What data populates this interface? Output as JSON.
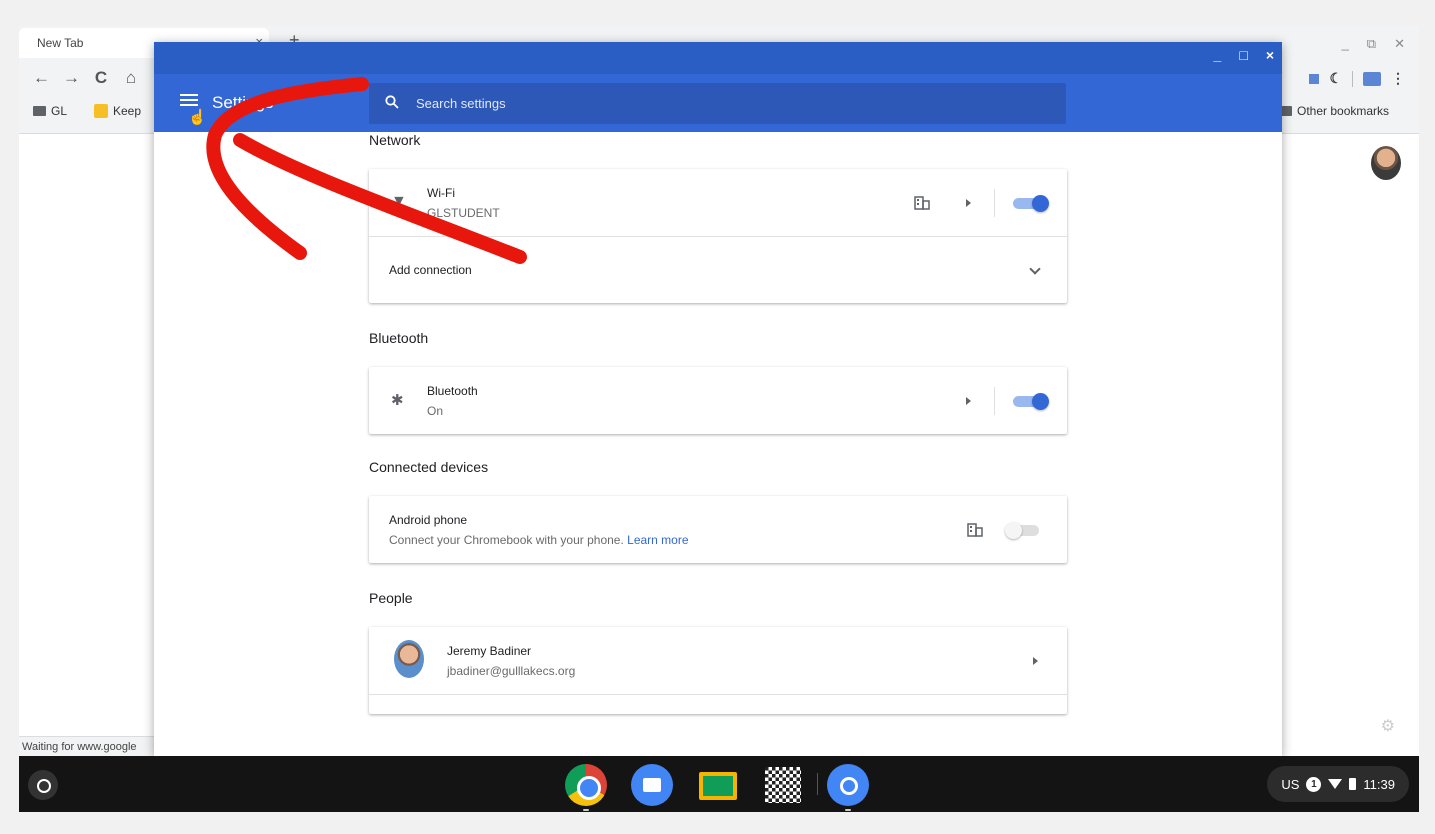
{
  "browser": {
    "tab_title": "New Tab",
    "tab_close": "×",
    "new_tab": "+",
    "bookmarks": [
      {
        "label": "GL"
      },
      {
        "label": "Keep"
      }
    ],
    "other_bookmarks": "Other bookmarks",
    "status_text": "Waiting for www.google"
  },
  "window": {
    "title_controls": [
      "_",
      "□",
      "×"
    ]
  },
  "header": {
    "title": "Settings",
    "search_placeholder": "Search settings"
  },
  "sections": {
    "network": {
      "title": "Network",
      "wifi_label": "Wi-Fi",
      "wifi_network": "GLSTUDENT",
      "add_connection": "Add connection",
      "wifi_enabled": true
    },
    "bluetooth": {
      "title": "Bluetooth",
      "label": "Bluetooth",
      "status": "On",
      "enabled": true
    },
    "connected_devices": {
      "title": "Connected devices",
      "label": "Android phone",
      "description": "Connect your Chromebook with your phone.",
      "link": "Learn more",
      "enabled": false
    },
    "people": {
      "title": "People",
      "name": "Jeremy Badiner",
      "email": "jbadiner@gulllakecs.org"
    }
  },
  "shelf": {
    "apps": [
      "chrome-icon",
      "files-icon",
      "classroom-icon",
      "qr-code-icon",
      "settings-icon"
    ]
  },
  "tray": {
    "input_method": "US",
    "notification_count": "1",
    "time": "11:39"
  },
  "colors": {
    "accent": "#3367d6",
    "titlebar": "#2b5ec4",
    "annotation": "#e8170e"
  }
}
